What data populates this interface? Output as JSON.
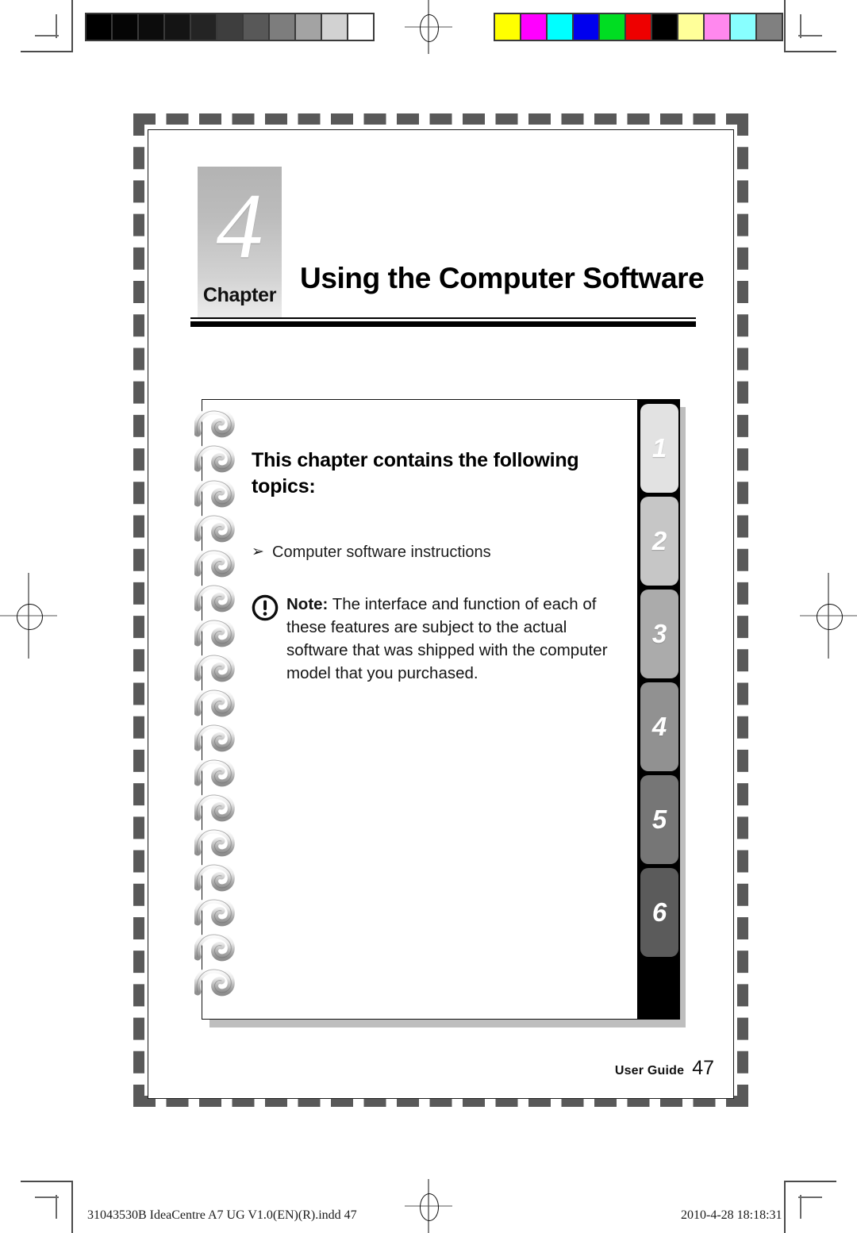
{
  "calibration": {
    "gray_bar": {
      "name": "grayscale-calibration-bar",
      "swatches": [
        "#000000",
        "#050505",
        "#0c0c0c",
        "#141414",
        "#242424",
        "#3e3e3e",
        "#585858",
        "#7d7d7d",
        "#a3a3a3",
        "#d2d2d2",
        "#ffffff"
      ]
    },
    "color_bar": {
      "name": "color-calibration-bar",
      "swatches": [
        "#ffff00",
        "#ff00ff",
        "#00ffff",
        "#0000ee",
        "#00dd22",
        "#ee0000",
        "#000000",
        "#ffff99",
        "#ff88ee",
        "#88ffff",
        "#808080"
      ]
    }
  },
  "chapter": {
    "number": "4",
    "label": "Chapter",
    "title": "Using the Computer Software"
  },
  "card": {
    "heading": "This chapter contains the following topics:",
    "topics": [
      {
        "bullet": "➢",
        "text": "Computer software instructions"
      }
    ],
    "note": {
      "icon": "exclamation-circle-icon",
      "prefix": "Note:",
      "body": " The interface and function of each of these features are subject to the actual software that was shipped with the computer model that you purchased."
    }
  },
  "tabs": [
    {
      "number": "1",
      "color": "#e2e2e2"
    },
    {
      "number": "2",
      "color": "#c6c6c6"
    },
    {
      "number": "3",
      "color": "#ababab"
    },
    {
      "number": "4",
      "color": "#919191"
    },
    {
      "number": "5",
      "color": "#767676"
    },
    {
      "number": "6",
      "color": "#5b5b5b"
    }
  ],
  "footer": {
    "guide_label": "User Guide",
    "page_number": "47"
  },
  "print_meta": {
    "file": "31043530B IdeaCentre A7 UG V1.0(EN)(R).indd   47",
    "timestamp": "2010-4-28   18:18:31"
  },
  "spiral": {
    "coil_count": 17
  }
}
